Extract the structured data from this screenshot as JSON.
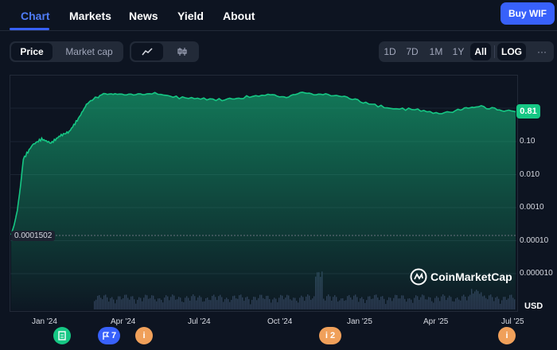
{
  "nav": {
    "tabs": [
      {
        "label": "Chart",
        "active": true
      },
      {
        "label": "Markets"
      },
      {
        "label": "News"
      },
      {
        "label": "Yield"
      },
      {
        "label": "About"
      }
    ],
    "buy_label": "Buy WIF"
  },
  "toolbar": {
    "metric_tabs": [
      {
        "label": "Price",
        "active": true
      },
      {
        "label": "Market cap"
      }
    ],
    "chart_type_icons": [
      "line-chart-icon",
      "candlestick-icon"
    ],
    "ranges": [
      {
        "label": "1D"
      },
      {
        "label": "7D"
      },
      {
        "label": "1M"
      },
      {
        "label": "1Y"
      },
      {
        "label": "All",
        "active": true
      }
    ],
    "log_label": "LOG",
    "more_label": "···"
  },
  "chart_data": {
    "type": "area",
    "scale": "log",
    "y_ticks": [
      "0.10",
      "0.010",
      "0.0010",
      "0.00010",
      "0.000010"
    ],
    "x_ticks": [
      "Jan '24",
      "Apr '24",
      "Jul '24",
      "Oct '24",
      "Jan '25",
      "Apr '25",
      "Jul '25"
    ],
    "current_price": "0.81",
    "start_price": "0.0001502",
    "currency": "USD",
    "color": "#16c784",
    "series": [
      {
        "points": [
          [
            2023.96,
            0.00015
          ],
          [
            2023.97,
            0.0003
          ],
          [
            2023.98,
            0.0008
          ],
          [
            2023.99,
            0.004
          ],
          [
            2024.0,
            0.03
          ],
          [
            2024.03,
            0.08
          ],
          [
            2024.06,
            0.12
          ],
          [
            2024.09,
            0.09
          ],
          [
            2024.12,
            0.15
          ],
          [
            2024.15,
            0.2
          ],
          [
            2024.18,
            0.5
          ],
          [
            2024.21,
            1.5
          ],
          [
            2024.25,
            2.5
          ],
          [
            2024.3,
            3.0
          ],
          [
            2024.36,
            2.5
          ],
          [
            2024.42,
            3.0
          ],
          [
            2024.5,
            2.2
          ],
          [
            2024.58,
            2.0
          ],
          [
            2024.66,
            1.8
          ],
          [
            2024.72,
            2.2
          ],
          [
            2024.8,
            2.6
          ],
          [
            2024.86,
            2.3
          ],
          [
            2024.92,
            3.0
          ],
          [
            2024.98,
            2.7
          ],
          [
            2025.05,
            2.3
          ],
          [
            2025.12,
            1.5
          ],
          [
            2025.2,
            1.0
          ],
          [
            2025.28,
            0.95
          ],
          [
            2025.36,
            0.7
          ],
          [
            2025.43,
            0.9
          ],
          [
            2025.48,
            1.2
          ],
          [
            2025.55,
            0.95
          ],
          [
            2025.61,
            0.8
          ]
        ]
      }
    ]
  },
  "events": [
    {
      "icon": "document-icon",
      "label": "",
      "color": "#16c784"
    },
    {
      "icon": "flag-icon",
      "label": "7",
      "color": "#3861fb"
    },
    {
      "icon": "info-icon",
      "label": "",
      "color": "#f0a05a"
    },
    {
      "icon": "info-icon",
      "label": "2",
      "color": "#f0a05a"
    },
    {
      "icon": "info-icon",
      "label": "",
      "color": "#f0a05a"
    }
  ],
  "watermark": "CoinMarketCap"
}
